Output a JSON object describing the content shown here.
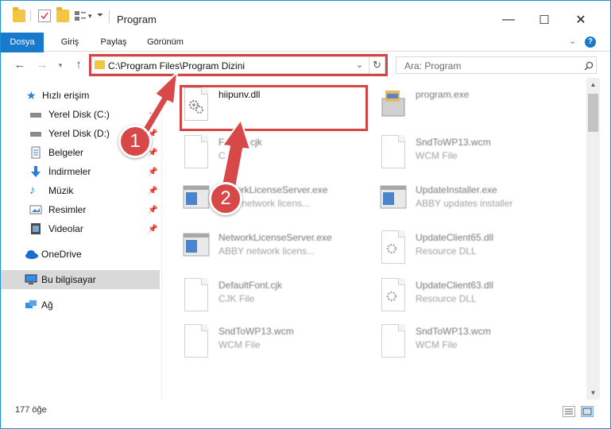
{
  "window": {
    "title": "Program",
    "controls": {
      "minimize": "—",
      "maximize": "☐",
      "close": "✕"
    }
  },
  "ribbon": {
    "tabs": [
      "Dosya",
      "Giriş",
      "Paylaş",
      "Görünüm"
    ],
    "help": "?"
  },
  "navigation": {
    "address": "C:\\Program Files\\Program Dizini",
    "search_placeholder": "Ara: Program"
  },
  "sidebar": {
    "items": [
      {
        "label": "Hızlı erişim",
        "icon": "star-icon"
      },
      {
        "label": "Yerel Disk (C:)",
        "icon": "drive-icon",
        "pinned": true
      },
      {
        "label": "Yerel Disk (D:)",
        "icon": "drive-icon",
        "pinned": true
      },
      {
        "label": "Belgeler",
        "icon": "documents-icon",
        "pinned": true
      },
      {
        "label": "İndirmeler",
        "icon": "download-icon",
        "pinned": true
      },
      {
        "label": "Müzik",
        "icon": "music-icon",
        "pinned": true
      },
      {
        "label": "Resimler",
        "icon": "pictures-icon",
        "pinned": true
      },
      {
        "label": "Videolar",
        "icon": "video-icon",
        "pinned": true
      },
      {
        "label": "OneDrive",
        "icon": "cloud-icon"
      },
      {
        "label": "Bu bilgisayar",
        "icon": "computer-icon",
        "selected": true
      },
      {
        "label": "Ağ",
        "icon": "network-icon"
      }
    ]
  },
  "files": {
    "left": [
      {
        "name": "hiipunv.dll",
        "type": ""
      },
      {
        "name": "Fa...ml.cjk",
        "type": "C...e"
      },
      {
        "name": "...tworkLicenseServer.exe",
        "type": "...BY network licens..."
      },
      {
        "name": "NetworkLicenseServer.exe",
        "type": "ABBY network licens..."
      },
      {
        "name": "DefaultFont.cjk",
        "type": "CJK File"
      },
      {
        "name": "SndToWP13.wcm",
        "type": "WCM File"
      }
    ],
    "right": [
      {
        "name": "program.exe",
        "type": ""
      },
      {
        "name": "SndToWP13.wcm",
        "type": "WCM File"
      },
      {
        "name": "UpdateInstaller.exe",
        "type": "ABBY updates installer"
      },
      {
        "name": "UpdateClient65.dll",
        "type": "Resource DLL"
      },
      {
        "name": "UpdateClient63.dll",
        "type": "Resource DLL"
      },
      {
        "name": "SndToWP13.wcm",
        "type": "WCM File"
      }
    ]
  },
  "status": {
    "count": "177 öğe"
  },
  "annotations": {
    "step1": "1",
    "step2": "2",
    "color": "#d64545"
  }
}
